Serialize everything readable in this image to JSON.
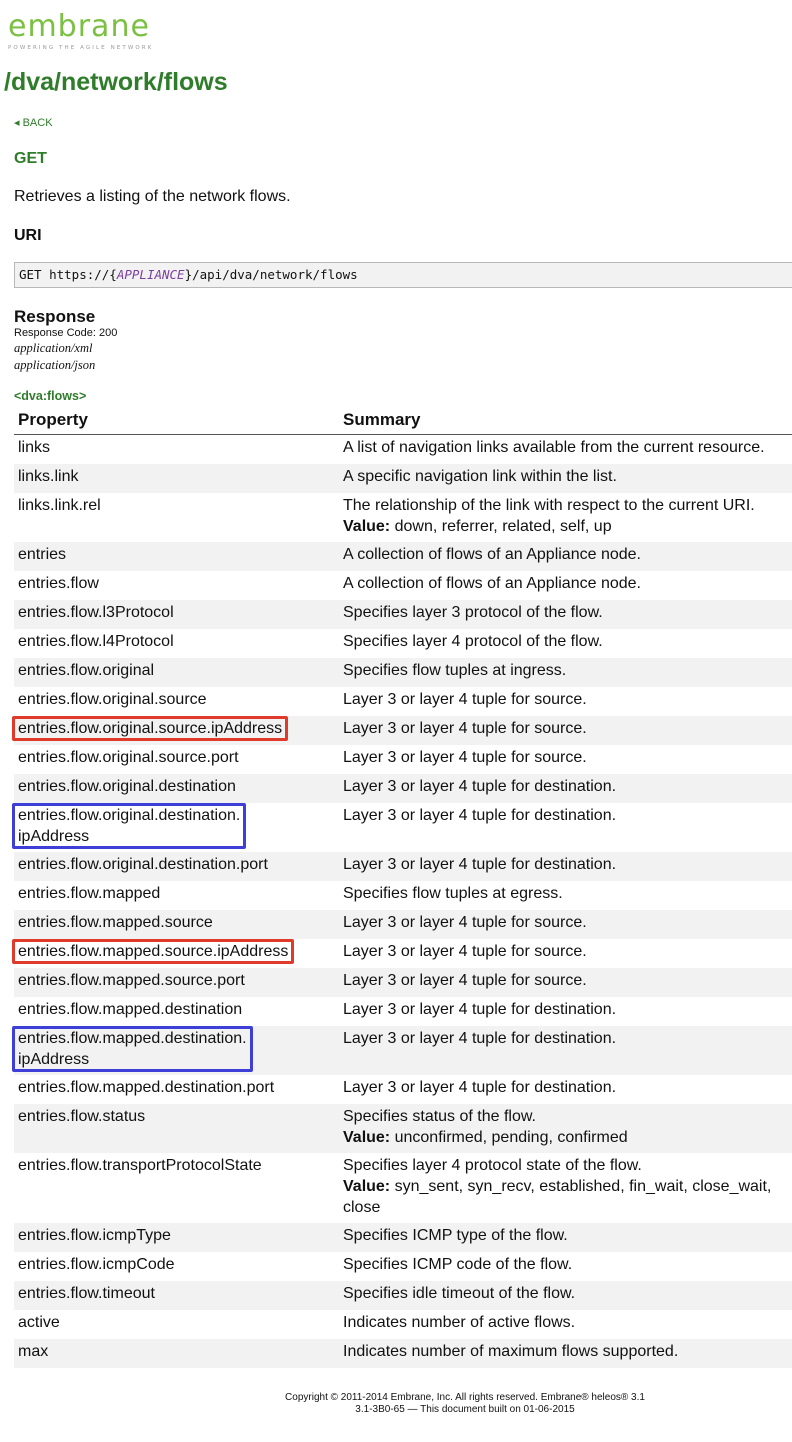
{
  "logo": {
    "text": "embrane",
    "tagline": "POWERING THE AGILE NETWORK"
  },
  "page_title": "/dva/network/flows",
  "back_link": "◂ BACK",
  "method": "GET",
  "description": "Retrieves a listing of the network flows.",
  "uri": {
    "heading": "URI",
    "prefix": "GET https://{",
    "variable": "APPLIANCE",
    "suffix": "}/api/dva/network/flows"
  },
  "response": {
    "heading": "Response",
    "code": "Response Code: 200",
    "media_types": [
      "application/xml",
      "application/json"
    ]
  },
  "element_tag": "<dva:flows>",
  "table": {
    "headers": [
      "Property",
      "Summary"
    ],
    "rows": [
      {
        "property": "links",
        "summary": "A list of navigation links available from the current resource."
      },
      {
        "property": "links.link",
        "summary": "A specific navigation link within the list."
      },
      {
        "property": "links.link.rel",
        "summary": "The relationship of the link with respect to the current URI.",
        "value": "down, referrer, related, self, up"
      },
      {
        "property": "entries",
        "summary": "A collection of flows of an Appliance node."
      },
      {
        "property": "entries.flow",
        "summary": "A collection of flows of an Appliance node."
      },
      {
        "property": "entries.flow.l3Protocol",
        "summary": "Specifies layer 3 protocol of the flow."
      },
      {
        "property": "entries.flow.l4Protocol",
        "summary": "Specifies layer 4 protocol of the flow."
      },
      {
        "property": "entries.flow.original",
        "summary": "Specifies flow tuples at ingress."
      },
      {
        "property": "entries.flow.original.source",
        "summary": "Layer 3 or layer 4 tuple for source."
      },
      {
        "property": "entries.flow.original.source.ipAddress",
        "summary": "Layer 3 or layer 4 tuple for source.",
        "highlight": "red"
      },
      {
        "property": "entries.flow.original.source.port",
        "summary": "Layer 3 or layer 4 tuple for source."
      },
      {
        "property": "entries.flow.original.destination",
        "summary": "Layer 3 or layer 4 tuple for destination."
      },
      {
        "property": "entries.flow.original.destination.\nipAddress",
        "summary": "Layer 3 or layer 4 tuple for destination.",
        "highlight": "blue"
      },
      {
        "property": "entries.flow.original.destination.port",
        "summary": "Layer 3 or layer 4 tuple for destination."
      },
      {
        "property": "entries.flow.mapped",
        "summary": "Specifies flow tuples at egress."
      },
      {
        "property": "entries.flow.mapped.source",
        "summary": "Layer 3 or layer 4 tuple for source."
      },
      {
        "property": "entries.flow.mapped.source.ipAddress",
        "summary": "Layer 3 or layer 4 tuple for source.",
        "highlight": "red"
      },
      {
        "property": "entries.flow.mapped.source.port",
        "summary": "Layer 3 or layer 4 tuple for source."
      },
      {
        "property": "entries.flow.mapped.destination",
        "summary": "Layer 3 or layer 4 tuple for destination."
      },
      {
        "property": "entries.flow.mapped.destination.\nipAddress",
        "summary": "Layer 3 or layer 4 tuple for destination.",
        "highlight": "blue"
      },
      {
        "property": "entries.flow.mapped.destination.port",
        "summary": "Layer 3 or layer 4 tuple for destination."
      },
      {
        "property": "entries.flow.status",
        "summary": "Specifies status of the flow.",
        "value": "unconfirmed, pending, confirmed"
      },
      {
        "property": "entries.flow.transportProtocolState",
        "summary": "Specifies layer 4 protocol state of the flow.",
        "value": "syn_sent, syn_recv, established, fin_wait, close_wait,\nclose"
      },
      {
        "property": "entries.flow.icmpType",
        "summary": "Specifies ICMP type of the flow."
      },
      {
        "property": "entries.flow.icmpCode",
        "summary": "Specifies ICMP code of the flow."
      },
      {
        "property": "entries.flow.timeout",
        "summary": "Specifies idle timeout of the flow."
      },
      {
        "property": "active",
        "summary": "Indicates number of active flows."
      },
      {
        "property": "max",
        "summary": "Indicates number of maximum flows supported."
      }
    ],
    "value_label": "Value:"
  },
  "footer": {
    "line1": "Copyright © 2011-2014 Embrane, Inc. All rights reserved. Embrane® heleos® 3.1",
    "line2": "3.1-3B0-65 — This document built on 01-06-2015"
  },
  "colors": {
    "brand_green": "#2f7d2a",
    "logo_green": "#7cc043",
    "highlight_red": "#e03a2b",
    "highlight_blue": "#3d3fd6"
  }
}
